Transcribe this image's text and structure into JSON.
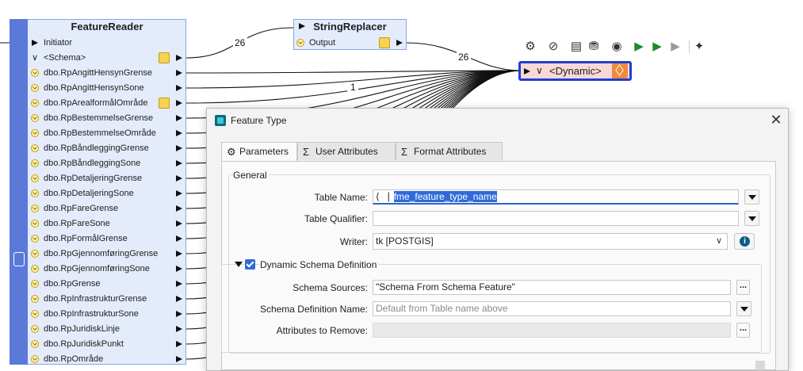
{
  "feature_reader": {
    "title": "FeatureReader",
    "initiator": "Initiator",
    "schema": "<Schema>",
    "ports": [
      "dbo.RpAngittHensynGrense",
      "dbo.RpAngittHensynSone",
      "dbo.RpArealformålOmråde",
      "dbo.RpBestemmelseGrense",
      "dbo.RpBestemmelseOmråde",
      "dbo.RpBåndleggingGrense",
      "dbo.RpBåndleggingSone",
      "dbo.RpDetaljeringGrense",
      "dbo.RpDetaljeringSone",
      "dbo.RpFareGrense",
      "dbo.RpFareSone",
      "dbo.RpFormålGrense",
      "dbo.RpGjennomføringGrense",
      "dbo.RpGjennomføringSone",
      "dbo.RpGrense",
      "dbo.RpInfrastrukturGrense",
      "dbo.RpInfrastrukturSone",
      "dbo.RpJuridiskLinje",
      "dbo.RpJuridiskPunkt",
      "dbo.RpOmråde"
    ]
  },
  "string_replacer": {
    "title": "StringReplacer",
    "output": "Output"
  },
  "dynamic_writer": {
    "label": "<Dynamic>"
  },
  "connection_counts": {
    "schema_to_replacer": "26",
    "replacer_to_dynamic": "26",
    "port_to_dynamic": "1"
  },
  "toolbar": {
    "icons": [
      "gear-icon",
      "disable-icon",
      "inspect-icon",
      "cache-settings-icon",
      "view-cache-icon",
      "run-to-this-icon",
      "run-icon",
      "run-from-icon",
      "quick-add-icon"
    ]
  },
  "dialog": {
    "title": "Feature Type",
    "tabs": [
      "Parameters",
      "User Attributes",
      "Format Attributes"
    ],
    "general_label": "General",
    "table_name_label": "Table Name:",
    "table_name_value": "fme_feature_type_name",
    "table_qualifier_label": "Table Qualifier:",
    "table_qualifier_value": "",
    "writer_label": "Writer:",
    "writer_value": "tk [POSTGIS]",
    "dynamic_schema_label": "Dynamic Schema Definition",
    "schema_sources_label": "Schema Sources:",
    "schema_sources_value": "\"Schema From Schema Feature\"",
    "schema_def_name_label": "Schema Definition Name:",
    "schema_def_name_placeholder": "Default from Table name above",
    "attrs_remove_label": "Attributes to Remove:",
    "attrs_remove_value": ""
  },
  "colors": {
    "reader_strip": "#5b79d9",
    "transformer_fill": "#e4ecfb",
    "writer_fill": "#fbd8d8",
    "writer_border": "#1f3fd1",
    "selection": "#2f6bd7"
  }
}
